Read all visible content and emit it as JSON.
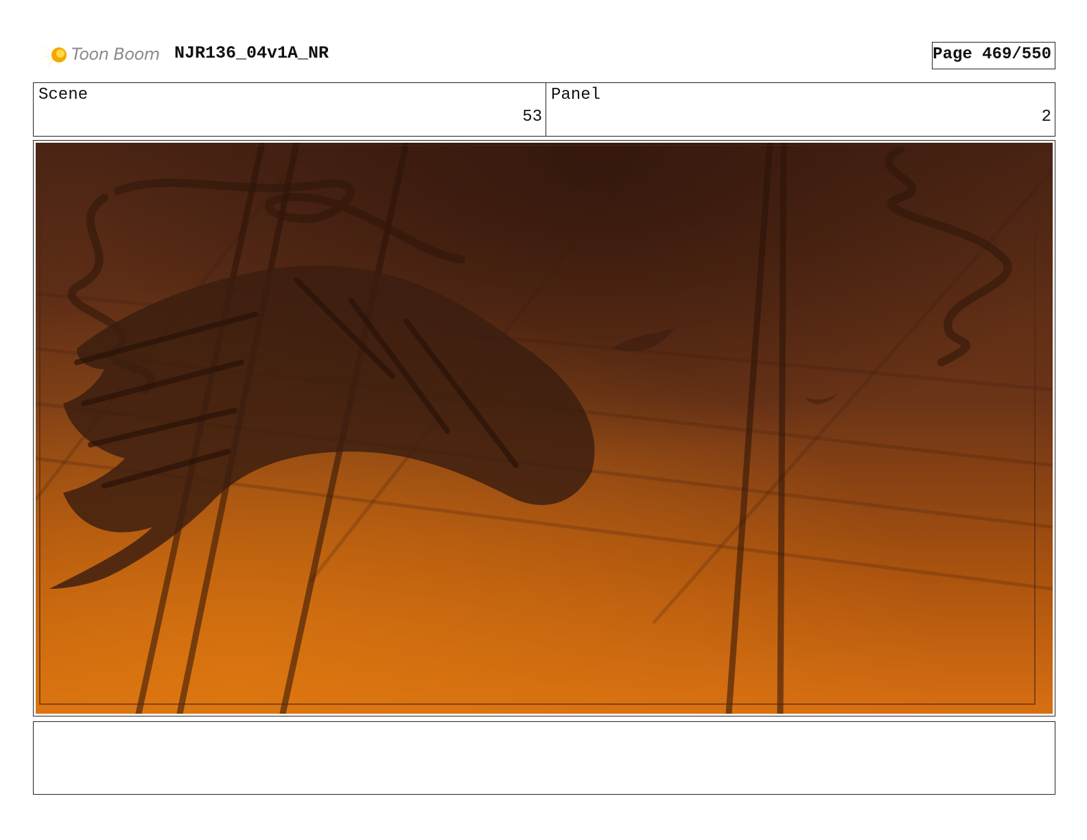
{
  "header": {
    "logo_text": "Toon Boom",
    "doc_title": "NJR136_04v1A_NR",
    "page_label": "Page 469/550"
  },
  "scene": {
    "label": "Scene",
    "value": "53"
  },
  "panel": {
    "label": "Panel",
    "value": "2"
  },
  "notes": {
    "text": ""
  },
  "colors": {
    "sky_top": "#4a2414",
    "sky_bottom": "#d86f12",
    "silhouette": "#3a1d10"
  }
}
